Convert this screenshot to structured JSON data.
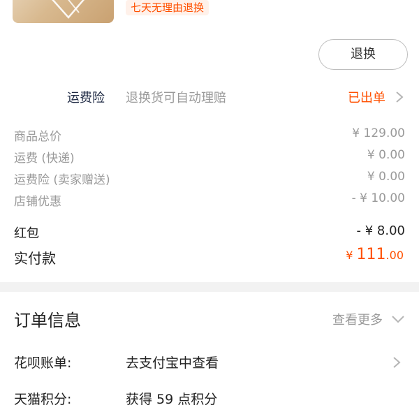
{
  "product": {
    "promise_tag": "七天无理由退换"
  },
  "actions": {
    "return_button": "退换"
  },
  "shipping_insurance": {
    "title": "运费险",
    "description": "退换货可自动理赔",
    "status": "已出单"
  },
  "price_details": [
    {
      "label": "商品总价",
      "value": "¥ 129.00"
    },
    {
      "label": "运费 (快递)",
      "value": "¥ 0.00"
    },
    {
      "label": "运费险 (卖家赠送)",
      "value": "¥ 0.00"
    },
    {
      "label": "店铺优惠",
      "value": "- ¥ 10.00"
    },
    {
      "label": "红包",
      "value": "- ¥ 8.00"
    }
  ],
  "paid": {
    "label": "实付款",
    "currency": "¥",
    "integer": "111",
    "decimal": ".00"
  },
  "order_info": {
    "title": "订单信息",
    "more_label": "查看更多",
    "rows": [
      {
        "key": "花呗账单:",
        "value": "去支付宝中查看"
      },
      {
        "key": "天猫积分:",
        "value": "获得 59 点积分"
      }
    ]
  },
  "colors": {
    "accent": "#ff5000",
    "muted": "#9a9a9a",
    "text": "#222222",
    "divider": "#f2f2f2"
  }
}
